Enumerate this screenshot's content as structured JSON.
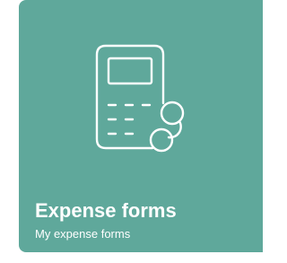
{
  "tile": {
    "title": "Expense forms",
    "subtitle": "My expense forms",
    "icon": "calculator-coins-icon",
    "background_color": "#5fa89b",
    "foreground_color": "#ffffff"
  }
}
